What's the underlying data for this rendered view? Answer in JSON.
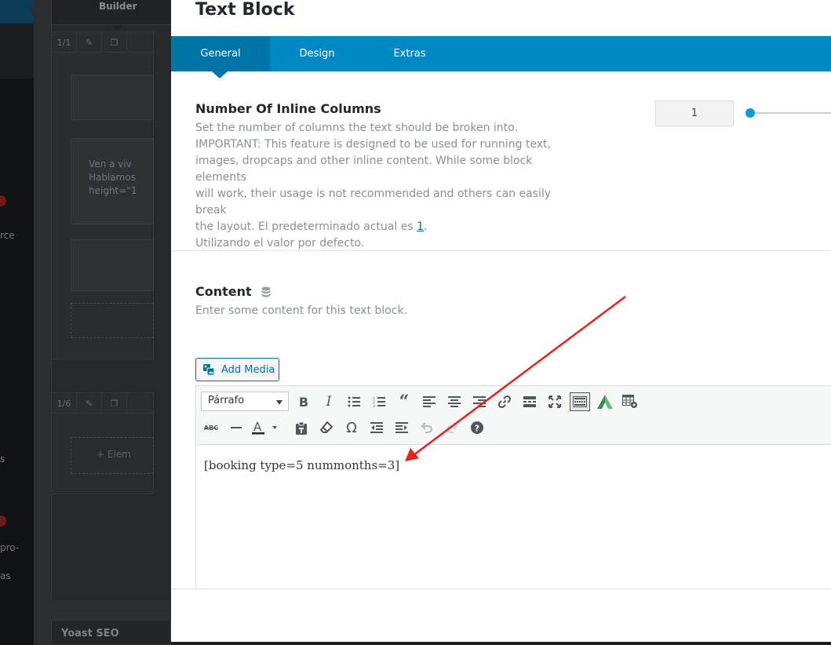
{
  "background": {
    "builder_label": "Builder",
    "column_1_size": "1/1",
    "column_2_size": "1/6",
    "element_text_lines": [
      "Ven a viv",
      "Hablamos",
      "height=\"1"
    ],
    "add_element_label": "+ Elem",
    "sidebar_labels": [
      "rce",
      "s",
      "pro-",
      "as"
    ],
    "yoast_label": "Yoast SEO"
  },
  "modal": {
    "title": "Text Block",
    "tabs": [
      {
        "label": "General",
        "active": true
      },
      {
        "label": "Design",
        "active": false
      },
      {
        "label": "Extras",
        "active": false
      }
    ],
    "columns_section": {
      "title": "Number Of Inline Columns",
      "desc_lines": [
        "Set the number of columns the text should be broken into.",
        "IMPORTANT: This feature is designed to be used for running text,",
        "images, dropcaps and other inline content. While some block elements",
        "will work, their usage is not recommended and others can easily break"
      ],
      "desc_default_prefix": "the layout. El predeterminado actual es ",
      "desc_default_value": "1",
      "desc_default_suffix": ".",
      "desc_using_default": "Utilizando el valor por defecto.",
      "value": "1"
    },
    "content_section": {
      "title": "Content",
      "desc": "Enter some content for this text block.",
      "add_media_label": "Add Media",
      "format_select": "Párrafo",
      "editor_text": "[booking type=5 nummonths=3]"
    }
  },
  "colors": {
    "tab_bar": "#0088c2",
    "tab_active": "#0073a8",
    "arrow": "#e8211b",
    "link": "#0073aa"
  }
}
